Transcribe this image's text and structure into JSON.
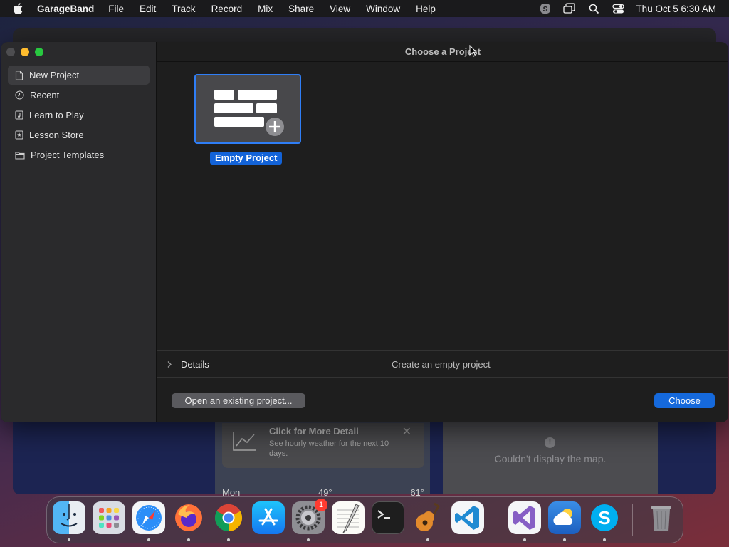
{
  "menubar": {
    "app_name": "GarageBand",
    "items": [
      "File",
      "Edit",
      "Track",
      "Record",
      "Mix",
      "Share",
      "View",
      "Window",
      "Help"
    ],
    "clock": "Thu Oct 5  6:30 AM",
    "status_icons": [
      "skype-status-icon",
      "screen-mirroring-icon",
      "spotlight-search-icon",
      "control-center-icon"
    ]
  },
  "background_app": {
    "weather_notice": {
      "title": "Click for More Detail",
      "subtitle": "See hourly weather for the next 10 days."
    },
    "weather_rows": [
      {
        "day": "Mon",
        "temp": "49°",
        "high": "61°"
      }
    ],
    "map_message": "Couldn't display the map."
  },
  "window": {
    "title": "Choose a Project",
    "sidebar": {
      "items": [
        {
          "label": "New Project",
          "icon": "document-icon",
          "selected": true
        },
        {
          "label": "Recent",
          "icon": "clock-icon",
          "selected": false
        },
        {
          "label": "Learn to Play",
          "icon": "music-note-icon",
          "selected": false
        },
        {
          "label": "Lesson Store",
          "icon": "star-icon",
          "selected": false
        },
        {
          "label": "Project Templates",
          "icon": "folder-icon",
          "selected": false
        }
      ]
    },
    "project": {
      "label": "Empty Project"
    },
    "details": {
      "label": "Details",
      "description": "Create an empty project"
    },
    "buttons": {
      "open_existing": "Open an existing project...",
      "choose": "Choose"
    }
  },
  "dock": {
    "apps": [
      {
        "name": "Finder",
        "icon": "finder-icon"
      },
      {
        "name": "Launchpad",
        "icon": "launchpad-icon"
      },
      {
        "name": "Safari",
        "icon": "safari-icon"
      },
      {
        "name": "Firefox",
        "icon": "firefox-icon"
      },
      {
        "name": "Chrome",
        "icon": "chrome-icon"
      },
      {
        "name": "App Store",
        "icon": "app-store-icon"
      },
      {
        "name": "System Settings",
        "icon": "settings-icon",
        "badge": "1"
      },
      {
        "name": "TextEdit",
        "icon": "textedit-icon"
      },
      {
        "name": "Terminal",
        "icon": "terminal-icon"
      },
      {
        "name": "GarageBand",
        "icon": "garageband-icon"
      },
      {
        "name": "VS Code",
        "icon": "vscode-icon"
      },
      {
        "name": "Visual Studio",
        "icon": "visual-studio-icon"
      },
      {
        "name": "Weather",
        "icon": "weather-icon"
      },
      {
        "name": "Skype",
        "icon": "skype-icon"
      },
      {
        "name": "Trash",
        "icon": "trash-icon"
      }
    ]
  },
  "colors": {
    "accent": "#1569dc",
    "selection_border": "#2f7ef6"
  }
}
